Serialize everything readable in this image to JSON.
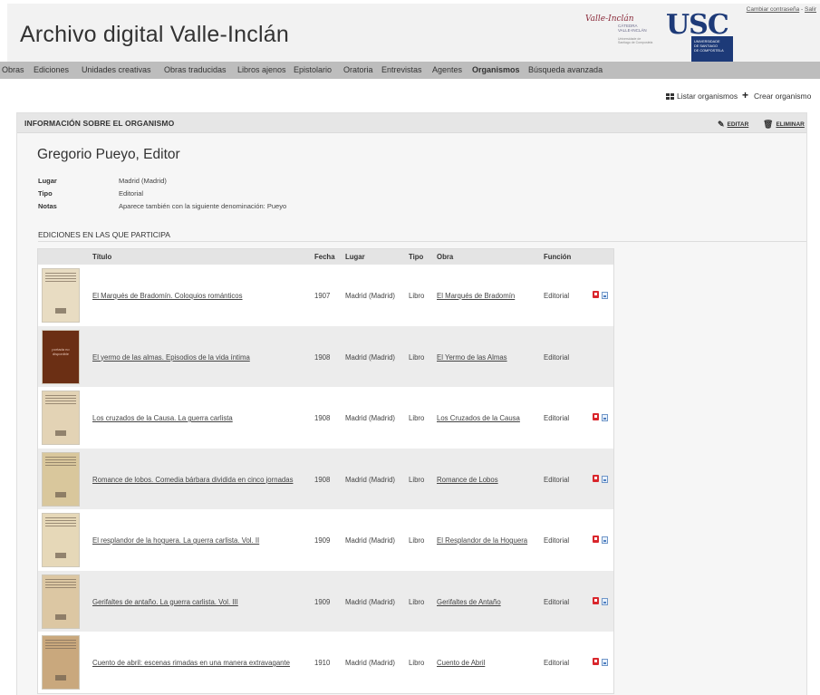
{
  "header": {
    "title": "Archivo digital Valle-Inclán",
    "account_links": {
      "change_password": "Cambiar contraseña",
      "separator": " - ",
      "logout": "Salir"
    },
    "catedra_logo": {
      "signature": "Valle-Inclán",
      "line1": "CÁTEDRA",
      "line2": "VALLE-INCLÁN",
      "sub1": "Universidade de",
      "sub2": "Santiago de Compostela"
    },
    "usc_logo": {
      "mark": "USC",
      "line1": "UNIVERSIDADE",
      "line2": "DE SANTIAGO",
      "line3": "DE COMPOSTELA"
    }
  },
  "nav": {
    "items": [
      {
        "label": "Obras"
      },
      {
        "label": "Ediciones"
      },
      {
        "label": "Unidades creativas"
      },
      {
        "label": "Obras traducidas"
      },
      {
        "label": "Libros ajenos"
      },
      {
        "label": "Epistolario"
      },
      {
        "label": "Oratoria"
      },
      {
        "label": "Entrevistas"
      },
      {
        "label": "Agentes"
      },
      {
        "label": "Organismos",
        "active": true
      },
      {
        "label": "Búsqueda avanzada"
      }
    ]
  },
  "actions": {
    "list_label": "Listar organismos",
    "create_label": "Crear organismo"
  },
  "panel": {
    "title": "INFORMACIÓN SOBRE EL ORGANISMO",
    "edit_label": "EDITAR",
    "delete_label": "ELIMINAR",
    "org_name": "Gregorio Pueyo, Editor",
    "fields": [
      {
        "label": "Lugar",
        "value": "Madrid (Madrid)"
      },
      {
        "label": "Tipo",
        "value": "Editorial"
      },
      {
        "label": "Notas",
        "value": "Aparece también con la siguiente denominación: Pueyo"
      }
    ],
    "editions_title": "EDICIONES EN LAS QUE PARTICIPA"
  },
  "table": {
    "headers": {
      "titulo": "Título",
      "fecha": "Fecha",
      "lugar": "Lugar",
      "tipo": "Tipo",
      "obra": "Obra",
      "funcion": "Función"
    },
    "rows": [
      {
        "titulo": "El Marqués de Bradomín. Coloquios románticos",
        "fecha": "1907",
        "lugar": "Madrid (Madrid)",
        "tipo": "Libro",
        "obra": "El Marqués de Bradomín",
        "funcion": "Editorial",
        "has_files": true,
        "thumb_color": "#e8dcc2"
      },
      {
        "titulo": "El yermo de las almas. Episodios de la vida íntima",
        "fecha": "1908",
        "lugar": "Madrid (Madrid)",
        "tipo": "Libro",
        "obra": "El Yermo de las Almas",
        "funcion": "Editorial",
        "has_files": false,
        "thumb_color": "#6b2f14",
        "thumb_text": "portada no disponible"
      },
      {
        "titulo": "Los cruzados de la Causa. La guerra carlista",
        "fecha": "1908",
        "lugar": "Madrid (Madrid)",
        "tipo": "Libro",
        "obra": "Los Cruzados de la Causa",
        "funcion": "Editorial",
        "has_files": true,
        "thumb_color": "#e3d3b5"
      },
      {
        "titulo": "Romance de lobos. Comedia bárbara dividida en cinco jornadas",
        "fecha": "1908",
        "lugar": "Madrid (Madrid)",
        "tipo": "Libro",
        "obra": "Romance de Lobos",
        "funcion": "Editorial",
        "has_files": true,
        "thumb_color": "#d9c79c"
      },
      {
        "titulo": "El resplandor de la hoguera. La guerra carlista. Vol. II",
        "fecha": "1909",
        "lugar": "Madrid (Madrid)",
        "tipo": "Libro",
        "obra": "El Resplandor de la Hoguera",
        "funcion": "Editorial",
        "has_files": true,
        "thumb_color": "#e6d8b8"
      },
      {
        "titulo": "Gerifaltes de antaño. La guerra carlista. Vol. III",
        "fecha": "1909",
        "lugar": "Madrid (Madrid)",
        "tipo": "Libro",
        "obra": "Gerifaltes de Antaño",
        "funcion": "Editorial",
        "has_files": true,
        "thumb_color": "#dcc7a3"
      },
      {
        "titulo": "Cuento de abril: escenas rimadas en una manera extravagante",
        "fecha": "1910",
        "lugar": "Madrid (Madrid)",
        "tipo": "Libro",
        "obra": "Cuento de Abril",
        "funcion": "Editorial",
        "has_files": true,
        "thumb_color": "#c9a87d"
      }
    ]
  }
}
